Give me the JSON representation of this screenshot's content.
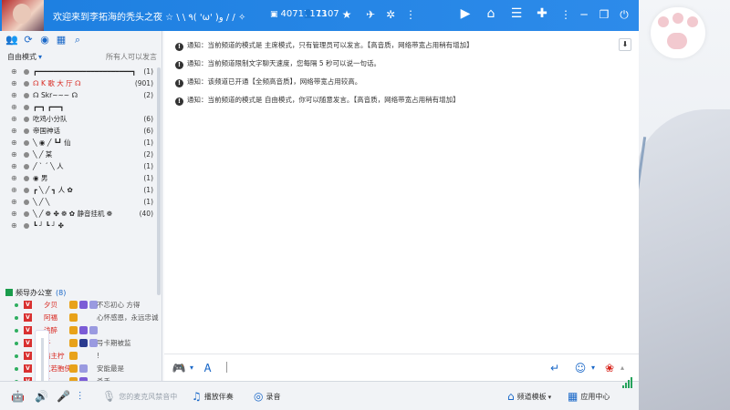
{
  "titlebar": {
    "welcome": "欢迎来到李拓海的秃头之夜 ☆ \\ \\ ٩( 'ω' )و / / ✧",
    "room_id": "40717173",
    "online_count": "1107"
  },
  "left_panel": {
    "mode_label": "自由模式",
    "permission_label": "所有人可以发言",
    "channels": [
      {
        "name": "┏━━━━━━━━━━━━━━━━━━━━━━━┓",
        "count": "(1)"
      },
      {
        "name": "☊  K  歌  大  厅  ☊",
        "count": "(901)"
      },
      {
        "name": "☊     Skr~~~    ☊",
        "count": "(2)"
      },
      {
        "name": "┏━┓        ┏━━┓",
        "count": ""
      },
      {
        "name": "吃鸡小分队",
        "count": "(6)"
      },
      {
        "name": "帝国神话",
        "count": "(6)"
      },
      {
        "name": "╲  ◉  ╱       ┗┛      仙",
        "count": "(1)"
      },
      {
        "name": "  ╲ ╱               某",
        "count": "(2)"
      },
      {
        "name": "╱ ˋ    ˊ ╲          人",
        "count": "(1)"
      },
      {
        "name": "    ◉                 男",
        "count": "(1)"
      },
      {
        "name": "┏ ╲ ╱ ┓            人  ✿",
        "count": "(1)"
      },
      {
        "name": "  ╲   ╱  ╲",
        "count": "(1)"
      },
      {
        "name": "╲ ╱  ❁  ✤ ❁ ✿       静音挂机 ❁",
        "count": "(40)"
      },
      {
        "name": "┗ ┘  ┗ ┘    ✤",
        "count": ""
      }
    ],
    "section": {
      "name": "频导办公室",
      "count": "(8)"
    },
    "members": [
      {
        "name": "夕贝",
        "sign": "不忘初心 方得"
      },
      {
        "name": "阿福",
        "sign": "心怀感恩，永远忠诚"
      },
      {
        "name": "浅醉",
        "sign": ""
      },
      {
        "name": "子",
        "sign": "号卡期被监"
      },
      {
        "name": "指主柠",
        "sign": "!"
      },
      {
        "name": "气若胞侠",
        "sign": "安能最是"
      },
      {
        "name": "子",
        "sign": "杀手"
      },
      {
        "name": "rangebaby",
        "sign": ""
      }
    ],
    "volume_badge": "20"
  },
  "messages": [
    {
      "text": "通知：当前频道的模式是 主席模式，只有管理员可以发言。【高音质，网络带宽占用稍有增加】"
    },
    {
      "text": "通知：当前频道限制文字聊天速度，您每隔 5 秒可以说一句话。"
    },
    {
      "text": "通知：该频道已开通【全频高音质】，网络带宽占用较高。"
    },
    {
      "text": "通知：当前频道的模式是 自由模式，你可以随意发言。【高音质，网络带宽占用稍有增加】"
    }
  ],
  "bottom_bar": {
    "mic_hint": "您的麦克风禁音中",
    "accompany": "播放伴奏",
    "record": "录音",
    "template": "频道模板",
    "app_center": "应用中心"
  },
  "colors": {
    "titlebar": "#1d7fe0",
    "accent": "#1a68c8",
    "green": "#26a35c",
    "red": "#d8261e"
  }
}
